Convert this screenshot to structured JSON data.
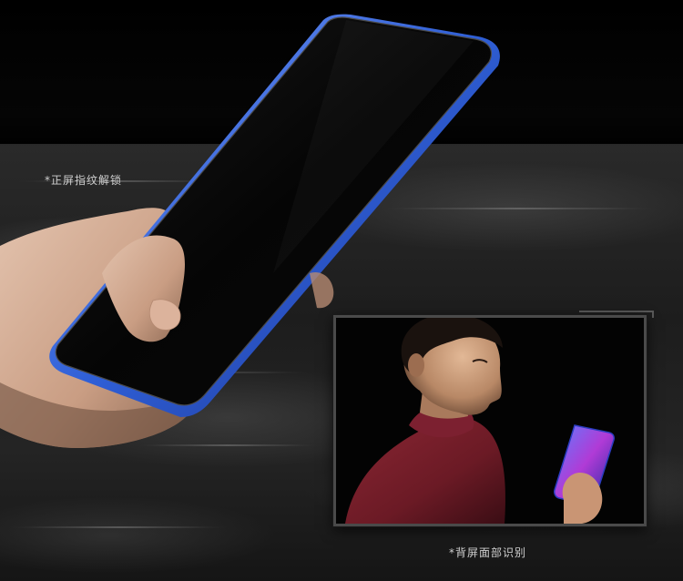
{
  "captions": {
    "fingerprint": "*正屏指纹解锁",
    "face": "*背屏面部识别"
  },
  "colors": {
    "background": "#000000",
    "phone_edge_blue": "#2f5fd6",
    "caption_text": "#cfcfcf",
    "sweater": "#7a1e2a"
  },
  "illustrations": {
    "phone": "hand-holding-phone",
    "portrait": "man-looking-at-phone"
  }
}
